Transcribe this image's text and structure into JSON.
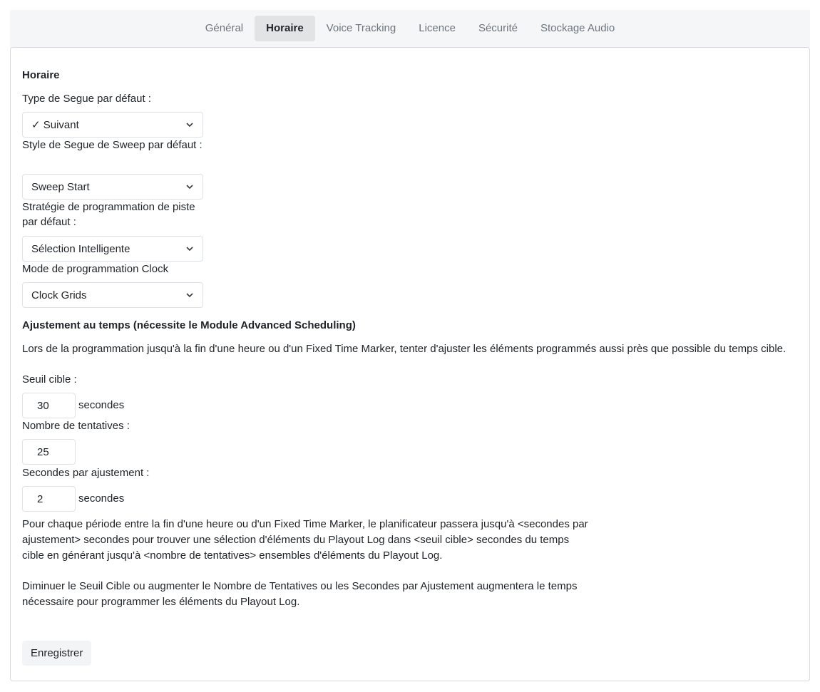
{
  "tabs": [
    {
      "label": "Général"
    },
    {
      "label": "Horaire"
    },
    {
      "label": "Voice Tracking"
    },
    {
      "label": "Licence"
    },
    {
      "label": "Sécurité"
    },
    {
      "label": "Stockage Audio"
    }
  ],
  "active_tab": "Horaire",
  "section": {
    "title": "Horaire",
    "segue_type_label": "Type de Segue par défaut :",
    "segue_type_value": "✓ Suivant",
    "sweep_style_label": "Style de Segue de Sweep par défaut :",
    "sweep_style_value": "Sweep Start",
    "strategy_label": "Stratégie de programmation de piste par défaut :",
    "strategy_value": "Sélection Intelligente",
    "clock_mode_label": "Mode de programmation Clock",
    "clock_mode_value": "Clock Grids"
  },
  "timefit": {
    "title": "Ajustement au temps (nécessite le Module Advanced Scheduling)",
    "description": "Lors de la programmation jusqu'à la fin d'une heure ou d'un Fixed Time Marker, tenter d'ajuster les éléments programmés aussi près que possible du temps cible.",
    "threshold_label": "Seuil cible :",
    "threshold_value": "30",
    "threshold_unit": "secondes",
    "attempts_label": "Nombre de tentatives :",
    "attempts_value": "25",
    "seconds_label": "Secondes par ajustement :",
    "seconds_value": "2",
    "seconds_unit": "secondes",
    "explanation": "Pour chaque période entre la fin d'une heure ou d'un Fixed Time Marker, le planificateur passera jusqu'à <secondes par ajustement> secondes pour trouver une sélection d'éléments du Playout Log dans <seuil cible> secondes du temps cible en générant jusqu'à <nombre de tentatives> ensembles d'éléments du Playout Log.",
    "note": "Diminuer le Seuil Cible ou augmenter le Nombre de Tentatives ou les Secondes par Ajustement augmentera le temps nécessaire pour programmer les éléments du Playout Log."
  },
  "save_label": "Enregistrer"
}
